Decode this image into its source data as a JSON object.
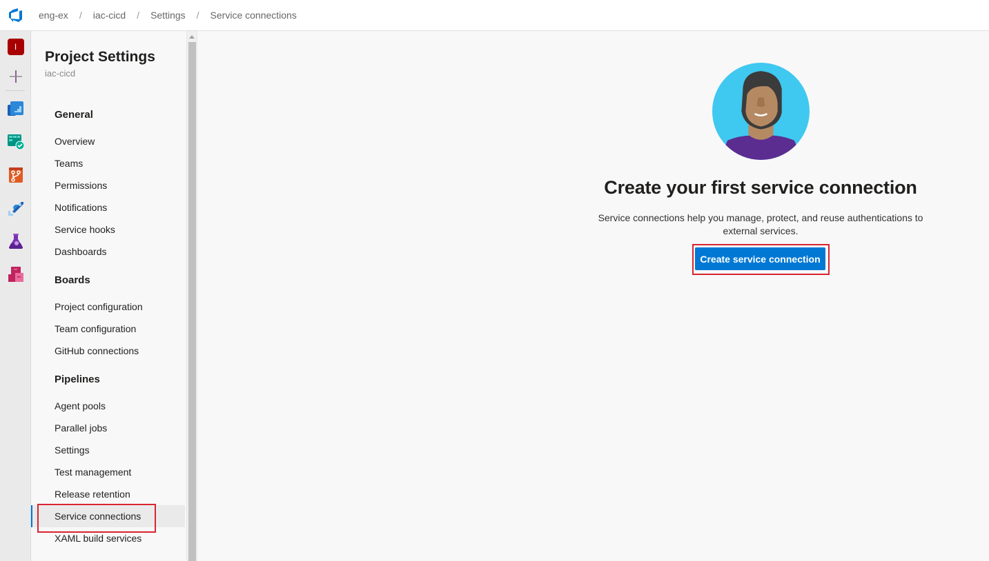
{
  "topbar": {
    "logo_icon": "azure-devops-logo",
    "breadcrumb": [
      "eng-ex",
      "iac-cicd",
      "Settings",
      "Service connections"
    ],
    "separator": "/"
  },
  "rail": {
    "org_initial": "I",
    "items": [
      {
        "name": "new-item",
        "icon": "plus-icon"
      },
      {
        "name": "overview",
        "icon": "overview-icon"
      },
      {
        "name": "boards",
        "icon": "boards-icon"
      },
      {
        "name": "repos",
        "icon": "repos-icon"
      },
      {
        "name": "pipelines",
        "icon": "pipelines-icon"
      },
      {
        "name": "test-plans",
        "icon": "test-plans-icon"
      },
      {
        "name": "artifacts",
        "icon": "artifacts-icon"
      }
    ]
  },
  "settings_nav": {
    "title": "Project Settings",
    "project": "iac-cicd",
    "groups": [
      {
        "label": "General",
        "items": [
          "Overview",
          "Teams",
          "Permissions",
          "Notifications",
          "Service hooks",
          "Dashboards"
        ]
      },
      {
        "label": "Boards",
        "items": [
          "Project configuration",
          "Team configuration",
          "GitHub connections"
        ]
      },
      {
        "label": "Pipelines",
        "items": [
          "Agent pools",
          "Parallel jobs",
          "Settings",
          "Test management",
          "Release retention",
          "Service connections",
          "XAML build services"
        ]
      }
    ],
    "selected": "Service connections"
  },
  "main": {
    "illustration": "person-avatar-illustration",
    "title": "Create your first service connection",
    "description": "Service connections help you manage, protect, and reuse authentications to external services.",
    "primary_button": "Create service connection"
  },
  "colors": {
    "accent": "#0078d4",
    "highlight": "#d9242f",
    "org_badge": "#a80000"
  }
}
